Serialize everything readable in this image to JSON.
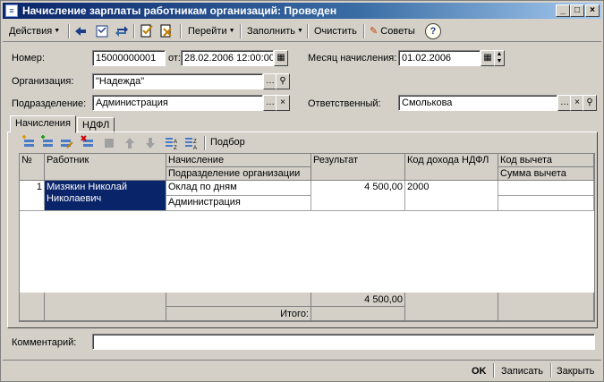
{
  "window": {
    "title": "Начисление зарплаты работникам организаций: Проведен"
  },
  "toolbar": {
    "actions": "Действия",
    "goto": "Перейти",
    "fill": "Заполнить",
    "clear": "Очистить",
    "tips": "Советы"
  },
  "form": {
    "number_label": "Номер:",
    "number_value": "15000000001",
    "date_label": "от:",
    "date_value": "28.02.2006 12:00:00",
    "month_label": "Месяц начисления:",
    "month_value": "01.02.2006",
    "org_label": "Организация:",
    "org_value": "\"Надежда\"",
    "dept_label": "Подразделение:",
    "dept_value": "Администрация",
    "resp_label": "Ответственный:",
    "resp_value": "Смолькова"
  },
  "tabs": [
    {
      "label": "Начисления",
      "active": true
    },
    {
      "label": "НДФЛ",
      "active": false
    }
  ],
  "table_toolbar": {
    "selection": "Подбор"
  },
  "table": {
    "headers": {
      "num": "№",
      "employee": "Работник",
      "accrual": "Начисление",
      "subdivision": "Подразделение организации",
      "result": "Результат",
      "income_code": "Код дохода НДФЛ",
      "deduction_code": "Код вычета",
      "deduction_sum": "Сумма вычета"
    },
    "rows": [
      {
        "num": "1",
        "employee": "Мизякин Николай Николаевич",
        "accrual": "Оклад по дням",
        "subdivision": "Администрация",
        "result": "4 500,00",
        "income_code": "2000",
        "deduction_code": "",
        "deduction_sum": ""
      }
    ],
    "total_value": "4 500,00",
    "total_label": "Итого:"
  },
  "comment_label": "Комментарий:",
  "comment_value": "",
  "bottom": {
    "ok": "OK",
    "save": "Записать",
    "close": "Закрыть"
  }
}
